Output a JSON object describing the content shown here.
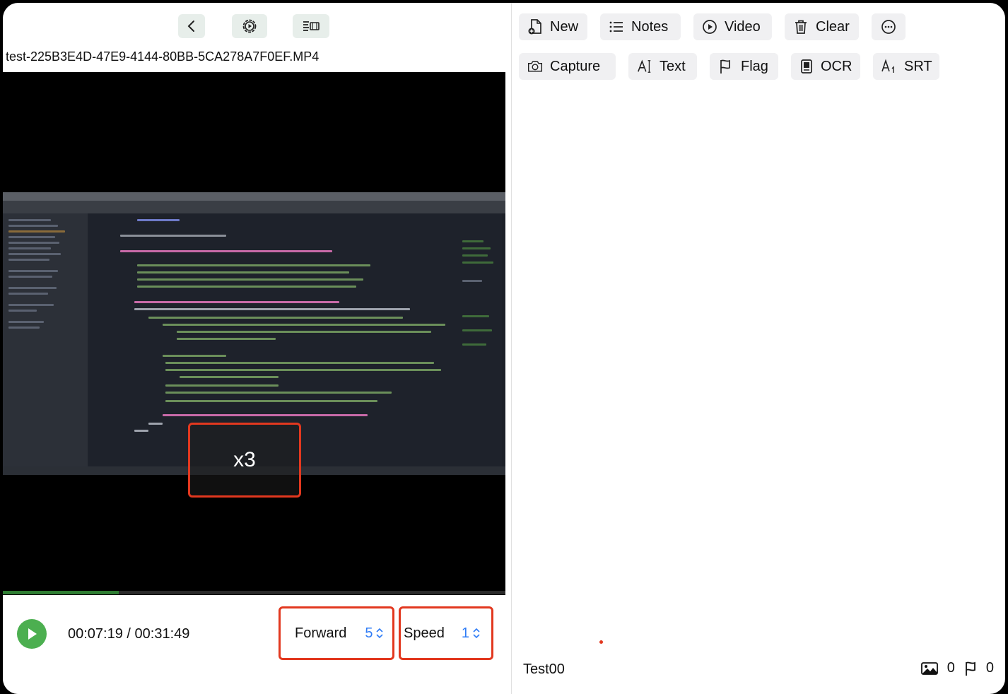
{
  "player": {
    "filename": "test-225B3E4D-47E9-4144-80BB-5CA278A7F0EF.MP4",
    "overlay_text": "x3",
    "progress_fraction": 0.23,
    "time_display": "00:07:19 / 00:31:49",
    "forward": {
      "label": "Forward",
      "value": "5"
    },
    "speed": {
      "label": "Speed",
      "value": "1"
    }
  },
  "toolbar": [
    {
      "label": "New",
      "icon": "new-document-icon"
    },
    {
      "label": "Notes",
      "icon": "list-icon"
    },
    {
      "label": "Video",
      "icon": "play-circle-icon"
    },
    {
      "label": "Clear",
      "icon": "trash-icon"
    },
    {
      "label": "",
      "icon": "more-icon"
    },
    {
      "label": "Capture",
      "icon": "camera-icon"
    },
    {
      "label": "Text",
      "icon": "text-cursor-icon"
    },
    {
      "label": "Flag",
      "icon": "flag-icon"
    },
    {
      "label": "OCR",
      "icon": "ocr-icon"
    },
    {
      "label": "SRT",
      "icon": "subtitle-icon"
    }
  ],
  "footer": {
    "session_name": "Test00",
    "image_count": "0",
    "flag_count": "0"
  },
  "colors": {
    "accent_green": "#4caf50",
    "highlight_red": "#e2381f",
    "value_blue": "#2f7cf6"
  }
}
